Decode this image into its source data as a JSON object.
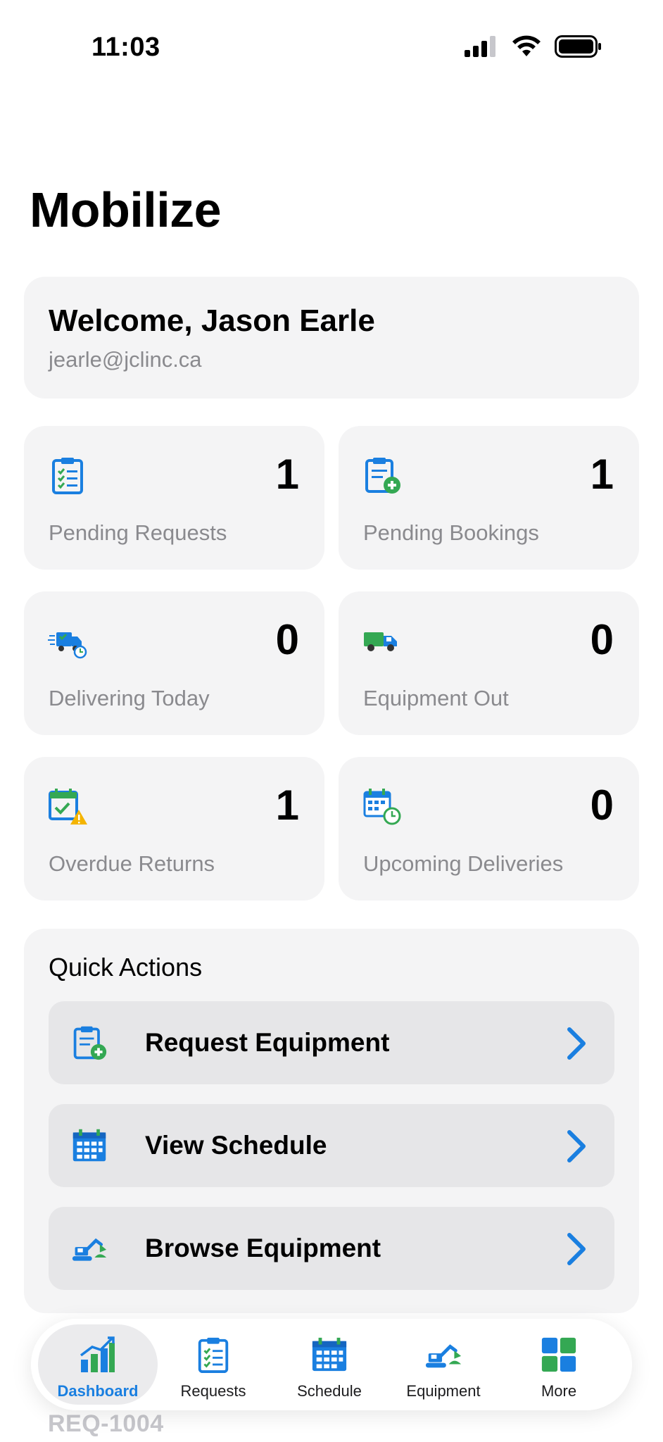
{
  "status_bar": {
    "time": "11:03"
  },
  "app_title": "Mobilize",
  "welcome": {
    "title": "Welcome, Jason Earle",
    "email": "jearle@jclinc.ca"
  },
  "stats": [
    {
      "icon": "clipboard-checklist-icon",
      "value": "1",
      "label": "Pending Requests"
    },
    {
      "icon": "clipboard-plus-icon",
      "value": "1",
      "label": "Pending Bookings"
    },
    {
      "icon": "delivery-truck-clock-icon",
      "value": "0",
      "label": "Delivering Today"
    },
    {
      "icon": "truck-icon",
      "value": "0",
      "label": "Equipment Out"
    },
    {
      "icon": "calendar-check-warning-icon",
      "value": "1",
      "label": "Overdue Returns"
    },
    {
      "icon": "calendar-clock-icon",
      "value": "0",
      "label": "Upcoming Deliveries"
    }
  ],
  "quick_actions": {
    "title": "Quick Actions",
    "items": [
      {
        "icon": "clipboard-plus-icon",
        "label": "Request Equipment"
      },
      {
        "icon": "calendar-icon",
        "label": "View Schedule"
      },
      {
        "icon": "excavator-icon",
        "label": "Browse Equipment"
      }
    ]
  },
  "under_text": "REQ-1004",
  "tabs": [
    {
      "icon": "bar-chart-icon",
      "label": "Dashboard",
      "active": true
    },
    {
      "icon": "clipboard-checklist-icon",
      "label": "Requests",
      "active": false
    },
    {
      "icon": "calendar-icon",
      "label": "Schedule",
      "active": false
    },
    {
      "icon": "excavator-icon",
      "label": "Equipment",
      "active": false
    },
    {
      "icon": "grid-icon",
      "label": "More",
      "active": false
    }
  ],
  "colors": {
    "accent": "#1a7fe0",
    "green": "#34a853",
    "warning": "#f4b400",
    "card_bg": "#f4f4f5",
    "label_gray": "#8a8a8e"
  }
}
